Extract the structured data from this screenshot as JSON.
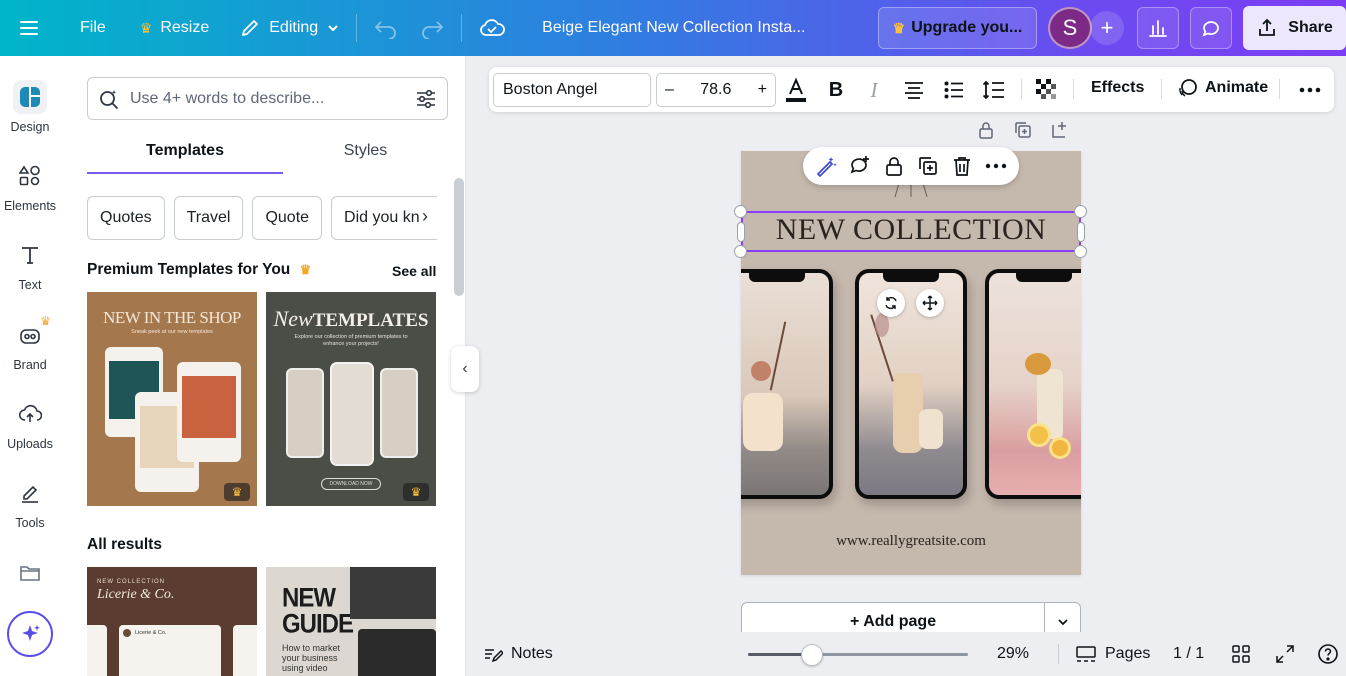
{
  "topbar": {
    "file_label": "File",
    "resize_label": "Resize",
    "editing_label": "Editing",
    "doc_title": "Beige Elegant New Collection Insta...",
    "upgrade_label": "Upgrade you...",
    "avatar_initial": "S",
    "share_label": "Share"
  },
  "rail": {
    "items": [
      {
        "label": "Design"
      },
      {
        "label": "Elements"
      },
      {
        "label": "Text"
      },
      {
        "label": "Brand"
      },
      {
        "label": "Uploads"
      },
      {
        "label": "Tools"
      }
    ]
  },
  "panel": {
    "search_placeholder": "Use 4+ words to describe...",
    "tabs": [
      {
        "label": "Templates"
      },
      {
        "label": "Styles"
      }
    ],
    "chips": [
      "Quotes",
      "Travel",
      "Quote",
      "Did you kn"
    ],
    "premium_title": "Premium Templates for You",
    "see_all": "See all",
    "all_results_title": "All results",
    "thumbs": [
      {
        "title": "NEW IN THE SHOP",
        "subtitle": "Sneak peek at our new templates"
      },
      {
        "title_script": "New",
        "title": "TEMPLATES",
        "subtitle": "Explore our collection of premium templates to enhance your projects!",
        "button": "DOWNLOAD NOW"
      },
      {
        "title": "NEW COLLECTION",
        "script": "Licerie & Co.",
        "tag": "Licerie & Co."
      },
      {
        "title_line1": "NEW",
        "title_line2": "GUIDE",
        "subtitle": "How to market your business using video"
      }
    ]
  },
  "texttoolbar": {
    "font_name": "Boston Angel",
    "font_size": "78.6",
    "effects_label": "Effects",
    "animate_label": "Animate"
  },
  "design": {
    "headline": "NEW COLLECTION",
    "url": "www.reallygreatsite.com"
  },
  "canvas": {
    "add_page_label": "+ Add page"
  },
  "bottombar": {
    "notes_label": "Notes",
    "zoom_percent": "29%",
    "zoom_level": 0.29,
    "pages_label": "Pages",
    "page_count": "1 / 1"
  },
  "colors": {
    "accent": "#8b3dff",
    "page_bg": "#c5b8ad",
    "crown": "#ffc13b"
  }
}
